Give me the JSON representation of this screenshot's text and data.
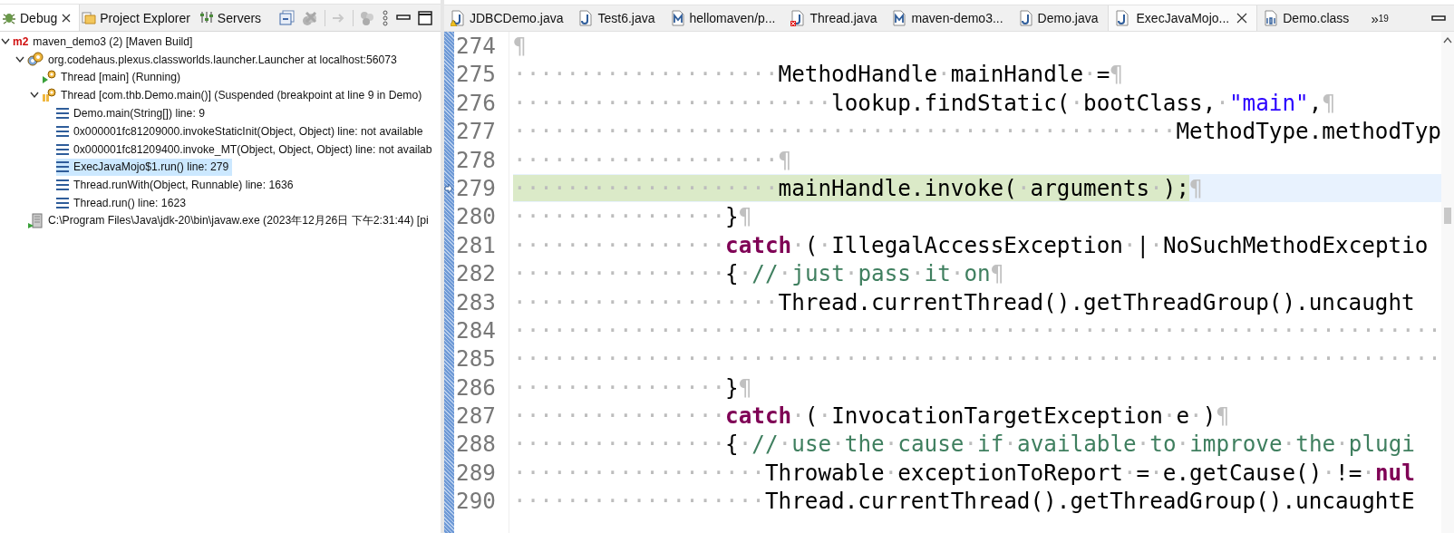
{
  "debug_view": {
    "tabs": [
      {
        "label": "Debug",
        "kind": "debug",
        "selected": true,
        "closable": true
      },
      {
        "label": "Project Explorer",
        "kind": "explorer",
        "selected": false,
        "closable": false
      },
      {
        "label": "Servers",
        "kind": "servers",
        "selected": false,
        "closable": false
      }
    ],
    "toolbar": [
      {
        "kind": "collapse",
        "disabled": false
      },
      {
        "kind": "remove",
        "disabled": true
      },
      {
        "kind": "separator"
      },
      {
        "kind": "step",
        "disabled": true
      },
      {
        "kind": "separator"
      },
      {
        "kind": "threads",
        "disabled": true
      },
      {
        "kind": "menu",
        "disabled": false
      },
      {
        "kind": "minimize",
        "disabled": false
      },
      {
        "kind": "maximize",
        "disabled": false
      }
    ],
    "tree": [
      {
        "kind": "launch",
        "badge": "m2",
        "label": "maven_demo3 (2) [Maven Build]",
        "selected": false,
        "expanded": true,
        "children": [
          {
            "kind": "target",
            "label": "org.codehaus.plexus.classworlds.launcher.Launcher at localhost:56073",
            "selected": false,
            "expanded": true,
            "children": [
              {
                "kind": "thread-running",
                "label": "Thread [main] (Running)",
                "selected": false
              },
              {
                "kind": "thread-suspended",
                "label": "Thread [com.thb.Demo.main()] (Suspended (breakpoint at line 9 in Demo)",
                "selected": false,
                "expanded": true,
                "children": [
                  {
                    "kind": "frame",
                    "label": "Demo.main(String[]) line: 9",
                    "selected": false
                  },
                  {
                    "kind": "frame",
                    "label": "0x000001fc81209000.invokeStaticInit(Object, Object) line: not available",
                    "selected": false
                  },
                  {
                    "kind": "frame",
                    "label": "0x000001fc81209400.invoke_MT(Object, Object, Object) line: not availab",
                    "selected": false
                  },
                  {
                    "kind": "frame",
                    "label": "ExecJavaMojo$1.run() line: 279",
                    "selected": true
                  },
                  {
                    "kind": "frame",
                    "label": "Thread.runWith(Object, Runnable) line: 1636",
                    "selected": false
                  },
                  {
                    "kind": "frame",
                    "label": "Thread.run() line: 1623",
                    "selected": false
                  }
                ]
              }
            ]
          },
          {
            "kind": "process",
            "label": "C:\\Program Files\\Java\\jdk-20\\bin\\javaw.exe (2023年12月26日 下午2:31:44) [pi",
            "selected": false
          }
        ]
      }
    ]
  },
  "editor": {
    "tabs": [
      {
        "label": "JDBCDemo.java",
        "kind": "java-warning",
        "selected": false
      },
      {
        "label": "Test6.java",
        "kind": "java",
        "selected": false
      },
      {
        "label": "hellomaven/p...",
        "kind": "maven",
        "selected": false
      },
      {
        "label": "Thread.java",
        "kind": "java-error",
        "selected": false
      },
      {
        "label": "maven-demo3...",
        "kind": "maven",
        "selected": false
      },
      {
        "label": "Demo.java",
        "kind": "java",
        "selected": false
      },
      {
        "label": "ExecJavaMojo...",
        "kind": "java",
        "selected": true
      },
      {
        "label": "Demo.class",
        "kind": "class",
        "selected": false
      }
    ],
    "overflow": {
      "chevron": "»",
      "count": "19"
    },
    "lines": [
      {
        "number": "274",
        "current": false,
        "tokens": [
          {
            "kind": "mark",
            "text": "¶"
          }
        ]
      },
      {
        "number": "275",
        "current": false,
        "tokens": [
          {
            "kind": "plain",
            "text": "····················MethodHandle·mainHandle·="
          },
          {
            "kind": "mark",
            "text": "¶"
          }
        ]
      },
      {
        "number": "276",
        "current": false,
        "tokens": [
          {
            "kind": "plain",
            "text": "························lookup.findStatic(·bootClass,·"
          },
          {
            "kind": "str",
            "text": "\"main\""
          },
          {
            "kind": "plain",
            "text": ","
          },
          {
            "kind": "mark",
            "text": "¶"
          }
        ]
      },
      {
        "number": "277",
        "current": false,
        "tokens": [
          {
            "kind": "plain",
            "text": "··················································MethodType.methodTyp"
          }
        ]
      },
      {
        "number": "278",
        "current": false,
        "tokens": [
          {
            "kind": "plain",
            "text": "····················"
          },
          {
            "kind": "mark",
            "text": "¶"
          }
        ]
      },
      {
        "number": "279",
        "current": true,
        "tokens": [
          {
            "kind": "plain",
            "text": "····················mainHandle.invoke(·arguments·);"
          },
          {
            "kind": "mark",
            "text": "¶"
          }
        ]
      },
      {
        "number": "280",
        "current": false,
        "tokens": [
          {
            "kind": "plain",
            "text": "················}"
          },
          {
            "kind": "mark",
            "text": "¶"
          }
        ]
      },
      {
        "number": "281",
        "current": false,
        "tokens": [
          {
            "kind": "plain",
            "text": "················"
          },
          {
            "kind": "kw",
            "text": "catch"
          },
          {
            "kind": "plain",
            "text": "·(·IllegalAccessException·|·NoSuchMethodExceptio"
          }
        ]
      },
      {
        "number": "282",
        "current": false,
        "tokens": [
          {
            "kind": "plain",
            "text": "················{·"
          },
          {
            "kind": "comment",
            "text": "//·just·pass·it·on"
          },
          {
            "kind": "mark",
            "text": "¶"
          }
        ]
      },
      {
        "number": "283",
        "current": false,
        "tokens": [
          {
            "kind": "plain",
            "text": "····················Thread.currentThread().getThreadGroup().uncaught"
          }
        ]
      },
      {
        "number": "284",
        "current": false,
        "tokens": [
          {
            "kind": "plain",
            "text": "······································································"
          }
        ]
      },
      {
        "number": "285",
        "current": false,
        "tokens": [
          {
            "kind": "plain",
            "text": "······································································"
          }
        ]
      },
      {
        "number": "286",
        "current": false,
        "tokens": [
          {
            "kind": "plain",
            "text": "················}"
          },
          {
            "kind": "mark",
            "text": "¶"
          }
        ]
      },
      {
        "number": "287",
        "current": false,
        "tokens": [
          {
            "kind": "plain",
            "text": "················"
          },
          {
            "kind": "kw",
            "text": "catch"
          },
          {
            "kind": "plain",
            "text": "·(·InvocationTargetException·e·)"
          },
          {
            "kind": "mark",
            "text": "¶"
          }
        ]
      },
      {
        "number": "288",
        "current": false,
        "tokens": [
          {
            "kind": "plain",
            "text": "················{·"
          },
          {
            "kind": "comment",
            "text": "//·use·the·cause·if·available·to·improve·the·plugi"
          }
        ]
      },
      {
        "number": "289",
        "current": false,
        "tokens": [
          {
            "kind": "plain",
            "text": "···················Throwable·exceptionToReport·=·e.getCause()·!=·"
          },
          {
            "kind": "kw",
            "text": "nul"
          }
        ]
      },
      {
        "number": "290",
        "current": false,
        "tokens": [
          {
            "kind": "plain",
            "text": "···················Thread.currentThread().getThreadGroup().uncaughtE"
          }
        ]
      }
    ]
  }
}
